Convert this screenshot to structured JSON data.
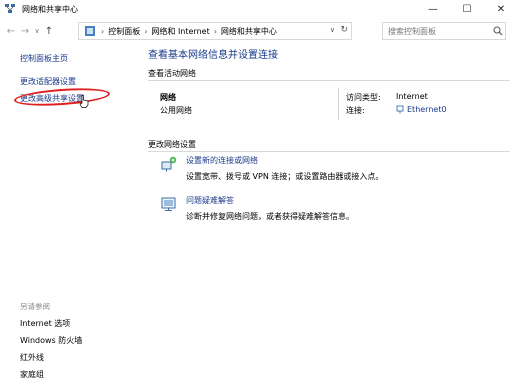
{
  "window": {
    "title": "网络和共享中心",
    "minimize": "—",
    "maximize": "☐",
    "close": "✕"
  },
  "nav": {
    "back": "←",
    "forward": "→",
    "dropdown": "∨",
    "up": "↑",
    "breadcrumbs": [
      "控制面板",
      "网络和 Internet",
      "网络和共享中心"
    ],
    "separator": "›",
    "address_dropdown": "∨",
    "refresh": "↻",
    "search_placeholder": "搜索控制面板"
  },
  "sidebar": {
    "links": [
      "控制面板主页",
      "更改适配器设置",
      "更改高级共享设置"
    ],
    "see_also_label": "另请参阅",
    "see_also": [
      "Internet 选项",
      "Windows 防火墙",
      "红外线",
      "家庭组"
    ]
  },
  "main": {
    "title": "查看基本网络信息并设置连接",
    "active_networks_label": "查看活动网络",
    "network_name": "网络",
    "network_type": "公用网络",
    "access_type_label": "访问类型:",
    "access_type_value": "Internet",
    "connection_label": "连接:",
    "connection_value": "Ethernet0",
    "change_settings_label": "更改网络设置",
    "tasks": [
      {
        "title": "设置新的连接或网络",
        "desc": "设置宽带、拨号或 VPN 连接；或设置路由器或接入点。"
      },
      {
        "title": "问题疑难解答",
        "desc": "诊断并修复网络问题，或者获得疑难解答信息。"
      }
    ]
  },
  "colors": {
    "link": "#1a3a8a",
    "highlight": "#e02020"
  }
}
